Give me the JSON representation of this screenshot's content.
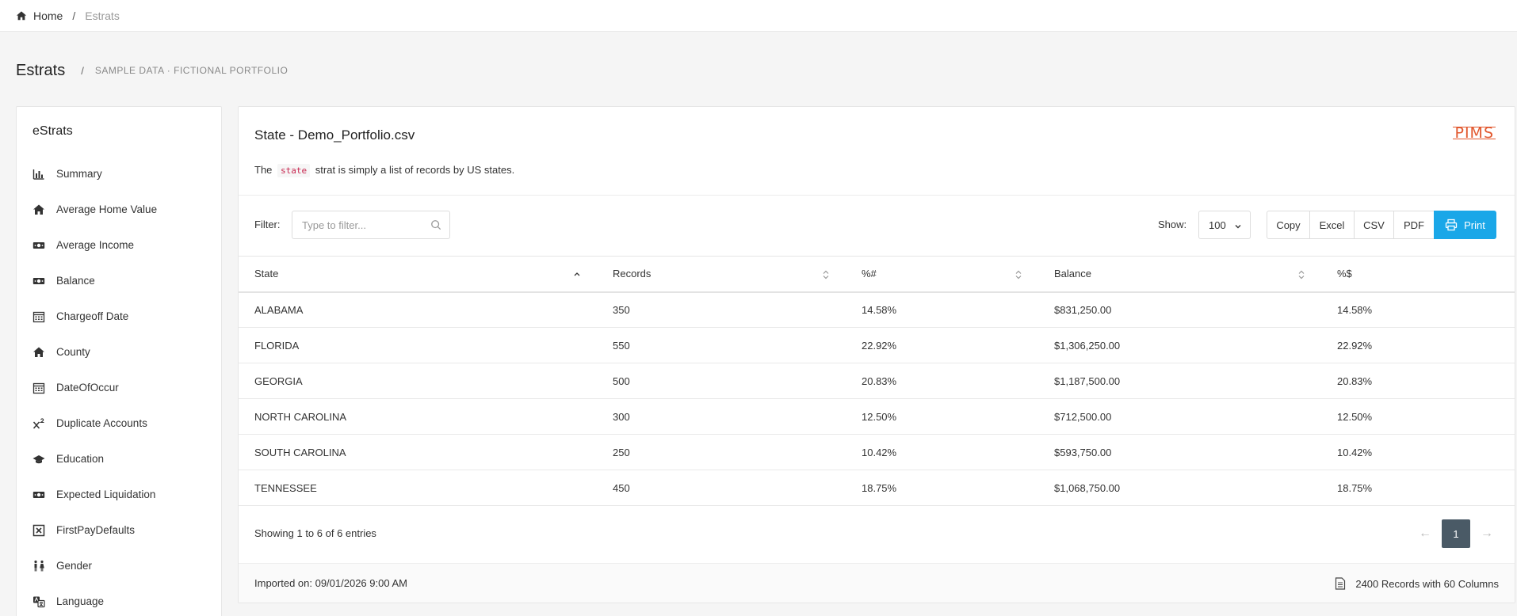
{
  "breadcrumb": {
    "home": "Home",
    "separator": "/",
    "current": "Estrats"
  },
  "header": {
    "title": "Estrats",
    "separator": "/",
    "subtitle": "SAMPLE DATA · FICTIONAL PORTFOLIO"
  },
  "sidebar": {
    "title": "eStrats",
    "items": [
      {
        "label": "Summary",
        "icon": "bar-chart-icon"
      },
      {
        "label": "Average Home Value",
        "icon": "home-icon"
      },
      {
        "label": "Average Income",
        "icon": "money-icon"
      },
      {
        "label": "Balance",
        "icon": "money-icon"
      },
      {
        "label": "Chargeoff Date",
        "icon": "calendar-icon"
      },
      {
        "label": "County",
        "icon": "home-icon"
      },
      {
        "label": "DateOfOccur",
        "icon": "calendar-icon"
      },
      {
        "label": "Duplicate Accounts",
        "icon": "superscript-icon"
      },
      {
        "label": "Education",
        "icon": "graduation-cap-icon"
      },
      {
        "label": "Expected Liquidation",
        "icon": "money-icon"
      },
      {
        "label": "FirstPayDefaults",
        "icon": "close-box-icon"
      },
      {
        "label": "Gender",
        "icon": "gender-icon"
      },
      {
        "label": "Language",
        "icon": "language-icon"
      }
    ]
  },
  "panel": {
    "title": "State - Demo_Portfolio.csv",
    "logo": "PIMS",
    "desc_prefix": "The",
    "desc_code": "state",
    "desc_suffix": "strat is simply a list of records by US states.",
    "filter_label": "Filter:",
    "filter_placeholder": "Type to filter...",
    "show_label": "Show:",
    "show_value": "100",
    "buttons": {
      "copy": "Copy",
      "excel": "Excel",
      "csv": "CSV",
      "pdf": "PDF",
      "print": "Print"
    }
  },
  "table": {
    "headers": [
      "State",
      "Records",
      "%#",
      "Balance",
      "%$"
    ],
    "rows": [
      [
        "ALABAMA",
        "350",
        "14.58%",
        "$831,250.00",
        "14.58%"
      ],
      [
        "FLORIDA",
        "550",
        "22.92%",
        "$1,306,250.00",
        "22.92%"
      ],
      [
        "GEORGIA",
        "500",
        "20.83%",
        "$1,187,500.00",
        "20.83%"
      ],
      [
        "NORTH CAROLINA",
        "300",
        "12.50%",
        "$712,500.00",
        "12.50%"
      ],
      [
        "SOUTH CAROLINA",
        "250",
        "10.42%",
        "$593,750.00",
        "10.42%"
      ],
      [
        "TENNESSEE",
        "450",
        "18.75%",
        "$1,068,750.00",
        "18.75%"
      ]
    ]
  },
  "pagination": {
    "info": "Showing 1 to 6 of 6 entries",
    "prev": "←",
    "current": "1",
    "next": "→"
  },
  "footer": {
    "imported": "Imported on: 09/01/2026 9:00 AM",
    "records": "2400 Records with 60 Columns"
  },
  "colors": {
    "accent": "#1aa7e8",
    "page_active": "#4a5a66",
    "logo": "#e2582e"
  }
}
